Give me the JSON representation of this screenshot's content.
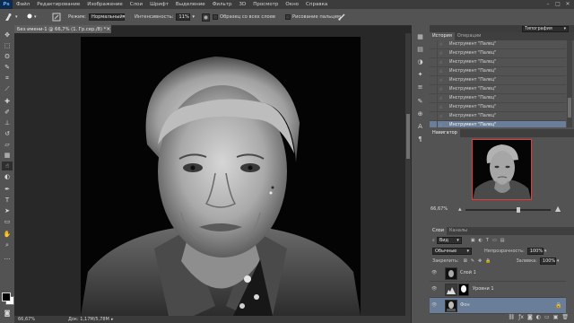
{
  "app": {
    "logo": "Ps"
  },
  "menu": [
    "Файл",
    "Редактирование",
    "Изображение",
    "Слои",
    "Шрифт",
    "Выделение",
    "Фильтр",
    "3D",
    "Просмотр",
    "Окно",
    "Справка"
  ],
  "window_controls": {
    "minimize": "–",
    "maximize": "□",
    "close": "✕"
  },
  "options_bar": {
    "size_value": "",
    "mode_label": "Режим:",
    "mode_value": "Нормальный",
    "intensity_label": "Интенсивность:",
    "intensity_value": "11%",
    "all_layers_label": "Образец со всех слоев",
    "finger_paint_label": "Рисование пальцем"
  },
  "workspace": {
    "value": "Типография"
  },
  "document": {
    "tab_title": "Без имени-1 @ 66,7% (1. Гр.сер./8) *",
    "zoom": "66,67%",
    "doc_size": "Док: 1,17M/5,78M"
  },
  "history_panel": {
    "tabs": [
      "История",
      "Операции"
    ],
    "items": [
      "Инструмент \"Палец\"",
      "Инструмент \"Палец\"",
      "Инструмент \"Палец\"",
      "Инструмент \"Палец\"",
      "Инструмент \"Палец\"",
      "Инструмент \"Палец\"",
      "Инструмент \"Палец\"",
      "Инструмент \"Палец\"",
      "Инструмент \"Палец\"",
      "Инструмент \"Палец\""
    ]
  },
  "navigator_panel": {
    "title": "Навигатор",
    "zoom": "66,67%"
  },
  "layers_panel": {
    "tabs": [
      "Слои",
      "Каналы"
    ],
    "kind_label": "Вид",
    "blend_mode": "Обычные",
    "opacity_label": "Непрозрачность:",
    "opacity_value": "100%",
    "lock_label": "Закрепить:",
    "fill_label": "Заливка:",
    "fill_value": "100%",
    "layers": [
      {
        "name": "Слой 1"
      },
      {
        "name": "Уровни 1"
      },
      {
        "name": "Фон"
      }
    ]
  }
}
